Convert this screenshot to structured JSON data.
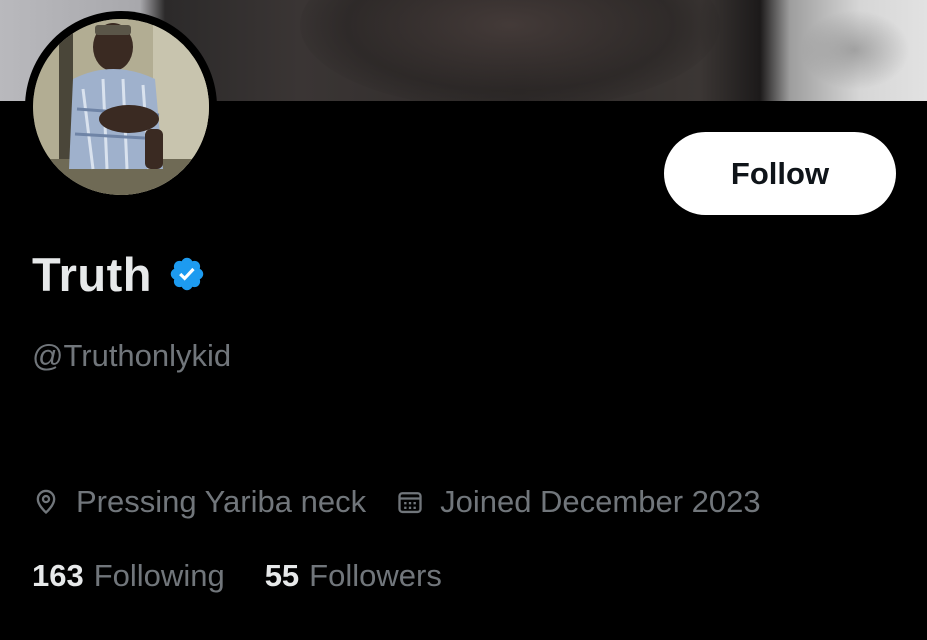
{
  "profile": {
    "display_name": "Truth",
    "handle": "@Truthonlykid",
    "verified": true,
    "follow_label": "Follow",
    "location": "Pressing Yariba neck",
    "joined": "Joined December 2023",
    "following_count": "163",
    "following_label": "Following",
    "followers_count": "55",
    "followers_label": "Followers"
  },
  "icons": {
    "verified": "verified-badge-icon",
    "location": "location-pin-icon",
    "calendar": "calendar-icon"
  },
  "colors": {
    "background": "#000000",
    "primary_text": "#e7e9ea",
    "secondary_text": "#71767b",
    "verified_blue": "#1d9bf0",
    "follow_button_bg": "#ffffff",
    "follow_button_text": "#0f1419"
  }
}
